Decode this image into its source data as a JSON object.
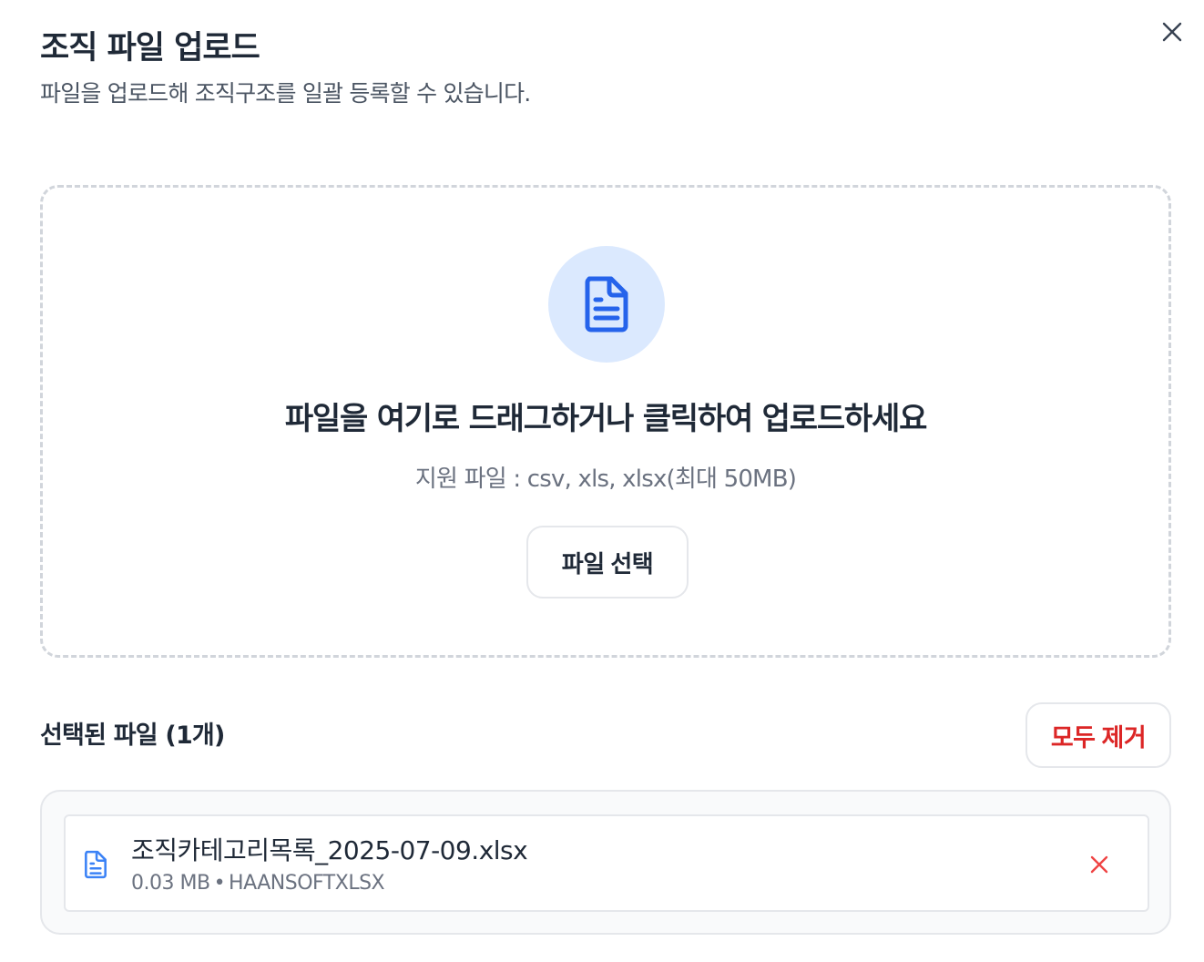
{
  "dialog": {
    "title": "조직 파일 업로드",
    "subtitle": "파일을 업로드해 조직구조를 일괄 등록할 수 있습니다.",
    "close_icon": "close-icon"
  },
  "dropzone": {
    "icon": "file-text-icon",
    "heading": "파일을 여기로 드래그하거나 클릭하여 업로드하세요",
    "hint": "지원 파일 : csv, xls, xlsx(최대 50MB)",
    "select_button": "파일 선택"
  },
  "selected": {
    "label": "선택된 파일 (1개)",
    "remove_all": "모두 제거",
    "files": [
      {
        "name": "조직카테고리목록_2025-07-09.xlsx",
        "size": "0.03 MB",
        "separator": "•",
        "type": "HAANSOFTXLSX",
        "icon": "file-text-icon",
        "remove_icon": "close-icon"
      }
    ]
  },
  "colors": {
    "accent_blue": "#2563eb",
    "icon_circle_bg": "#dbe9fe",
    "danger_red": "#dc2626",
    "dashed_border": "#d1d5db"
  }
}
